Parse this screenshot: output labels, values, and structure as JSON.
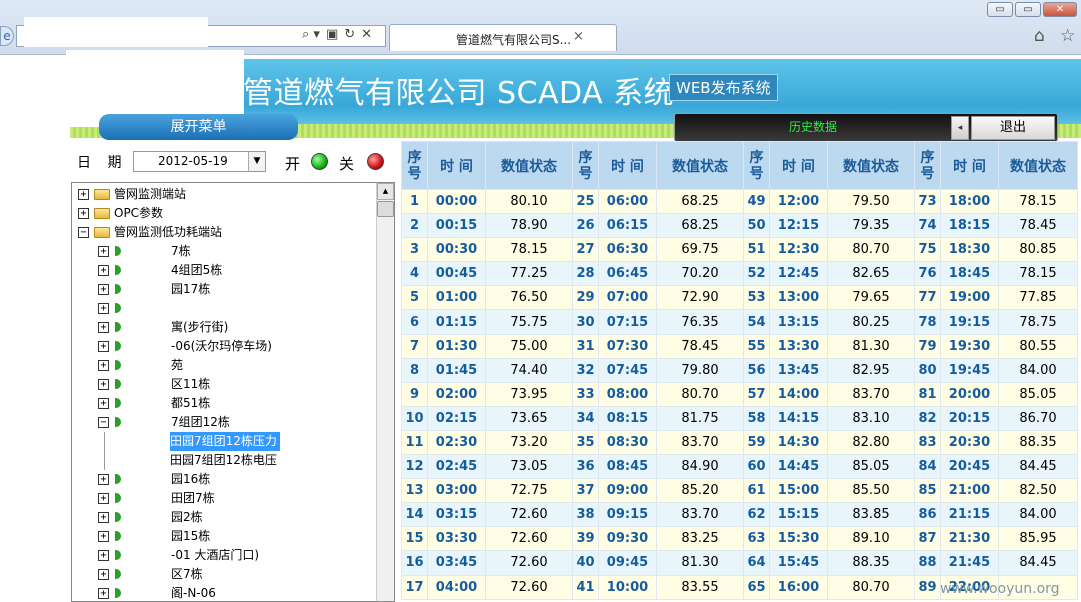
{
  "browser": {
    "tab_title": "管道燃气有限公司S...",
    "tab_close": "×",
    "address_tools": [
      "⌕ ▾",
      "▣",
      "↻",
      "✕"
    ],
    "window_controls": [
      "▭",
      "▭",
      "✕"
    ],
    "home_icon": "⌂",
    "favorites_icon": "☆"
  },
  "header": {
    "system_title": "管道燃气有限公司 SCADA 系统",
    "web_badge": "WEB发布系统",
    "expand_menu": "展开菜单",
    "history_label": "历史数据",
    "history_arrow": "◂",
    "logout": "退出"
  },
  "filter": {
    "date_label": "日 期",
    "date_value": "2012-05-19",
    "date_drop": "▼",
    "on_label": "开",
    "off_label": "关",
    "on_color": "#10b010",
    "off_color": "#d01010"
  },
  "tree": {
    "scroll_up": "▲",
    "nodes": [
      {
        "label": "管网监测端站",
        "toggle": "+",
        "kind": "folder",
        "level": 0
      },
      {
        "label": "OPC参数",
        "toggle": "+",
        "kind": "folder",
        "level": 0
      },
      {
        "label": "管网监测低功耗端站",
        "toggle": "−",
        "kind": "folder",
        "level": 0
      },
      {
        "label": "7栋",
        "toggle": "+",
        "kind": "leaf",
        "level": 1
      },
      {
        "label": "4组团5栋",
        "toggle": "+",
        "kind": "leaf",
        "level": 1
      },
      {
        "label": "园17栋",
        "toggle": "+",
        "kind": "leaf",
        "level": 1
      },
      {
        "label": "",
        "toggle": "+",
        "kind": "leaf",
        "level": 1
      },
      {
        "label": "寓(步行街)",
        "toggle": "+",
        "kind": "leaf",
        "level": 1
      },
      {
        "label": "-06(沃尔玛停车场)",
        "toggle": "+",
        "kind": "leaf",
        "level": 1
      },
      {
        "label": "苑",
        "toggle": "+",
        "kind": "leaf",
        "level": 1
      },
      {
        "label": "区11栋",
        "toggle": "+",
        "kind": "leaf",
        "level": 1
      },
      {
        "label": "都51栋",
        "toggle": "+",
        "kind": "leaf",
        "level": 1
      },
      {
        "label": "7组团12栋",
        "toggle": "−",
        "kind": "leaf",
        "level": 1
      },
      {
        "label": "田园7组团12栋压力",
        "toggle": "",
        "kind": "item",
        "level": 2,
        "selected": true
      },
      {
        "label": "田园7组团12栋电压",
        "toggle": "",
        "kind": "item",
        "level": 2
      },
      {
        "label": "园16栋",
        "toggle": "+",
        "kind": "leaf",
        "level": 1
      },
      {
        "label": "田团7栋",
        "toggle": "+",
        "kind": "leaf",
        "level": 1
      },
      {
        "label": "园2栋",
        "toggle": "+",
        "kind": "leaf",
        "level": 1
      },
      {
        "label": "园15栋",
        "toggle": "+",
        "kind": "leaf",
        "level": 1
      },
      {
        "label": "-01           大酒店门口)",
        "toggle": "+",
        "kind": "leaf",
        "level": 1
      },
      {
        "label": "区7栋",
        "toggle": "+",
        "kind": "leaf",
        "level": 1
      },
      {
        "label": "阁-N-06",
        "toggle": "+",
        "kind": "leaf",
        "level": 1
      }
    ]
  },
  "table": {
    "headers": [
      "序号",
      "时 间",
      "数值状态",
      "序号",
      "时 间",
      "数值状态",
      "序号",
      "时 间",
      "数值状态",
      "序号",
      "时 间",
      "数值状态"
    ],
    "rows": [
      [
        "1",
        "00:00",
        "80.10",
        "25",
        "06:00",
        "68.25",
        "49",
        "12:00",
        "79.50",
        "73",
        "18:00",
        "78.15"
      ],
      [
        "2",
        "00:15",
        "78.90",
        "26",
        "06:15",
        "68.25",
        "50",
        "12:15",
        "79.35",
        "74",
        "18:15",
        "78.45"
      ],
      [
        "3",
        "00:30",
        "78.15",
        "27",
        "06:30",
        "69.75",
        "51",
        "12:30",
        "80.70",
        "75",
        "18:30",
        "80.85"
      ],
      [
        "4",
        "00:45",
        "77.25",
        "28",
        "06:45",
        "70.20",
        "52",
        "12:45",
        "82.65",
        "76",
        "18:45",
        "78.15"
      ],
      [
        "5",
        "01:00",
        "76.50",
        "29",
        "07:00",
        "72.90",
        "53",
        "13:00",
        "79.65",
        "77",
        "19:00",
        "77.85"
      ],
      [
        "6",
        "01:15",
        "75.75",
        "30",
        "07:15",
        "76.35",
        "54",
        "13:15",
        "80.25",
        "78",
        "19:15",
        "78.75"
      ],
      [
        "7",
        "01:30",
        "75.00",
        "31",
        "07:30",
        "78.45",
        "55",
        "13:30",
        "81.30",
        "79",
        "19:30",
        "80.55"
      ],
      [
        "8",
        "01:45",
        "74.40",
        "32",
        "07:45",
        "79.80",
        "56",
        "13:45",
        "82.95",
        "80",
        "19:45",
        "84.00"
      ],
      [
        "9",
        "02:00",
        "73.95",
        "33",
        "08:00",
        "80.70",
        "57",
        "14:00",
        "83.70",
        "81",
        "20:00",
        "85.05"
      ],
      [
        "10",
        "02:15",
        "73.65",
        "34",
        "08:15",
        "81.75",
        "58",
        "14:15",
        "83.10",
        "82",
        "20:15",
        "86.70"
      ],
      [
        "11",
        "02:30",
        "73.20",
        "35",
        "08:30",
        "83.70",
        "59",
        "14:30",
        "82.80",
        "83",
        "20:30",
        "88.35"
      ],
      [
        "12",
        "02:45",
        "73.05",
        "36",
        "08:45",
        "84.90",
        "60",
        "14:45",
        "85.05",
        "84",
        "20:45",
        "84.45"
      ],
      [
        "13",
        "03:00",
        "72.75",
        "37",
        "09:00",
        "85.20",
        "61",
        "15:00",
        "85.50",
        "85",
        "21:00",
        "82.50"
      ],
      [
        "14",
        "03:15",
        "72.60",
        "38",
        "09:15",
        "83.70",
        "62",
        "15:15",
        "83.85",
        "86",
        "21:15",
        "84.00"
      ],
      [
        "15",
        "03:30",
        "72.60",
        "39",
        "09:30",
        "83.25",
        "63",
        "15:30",
        "89.10",
        "87",
        "21:30",
        "85.95"
      ],
      [
        "16",
        "03:45",
        "72.60",
        "40",
        "09:45",
        "81.30",
        "64",
        "15:45",
        "88.35",
        "88",
        "21:45",
        "84.45"
      ],
      [
        "17",
        "04:00",
        "72.60",
        "41",
        "10:00",
        "83.55",
        "65",
        "16:00",
        "80.70",
        "89",
        "22:00",
        ""
      ]
    ]
  },
  "watermark": "www.wooyun.org"
}
